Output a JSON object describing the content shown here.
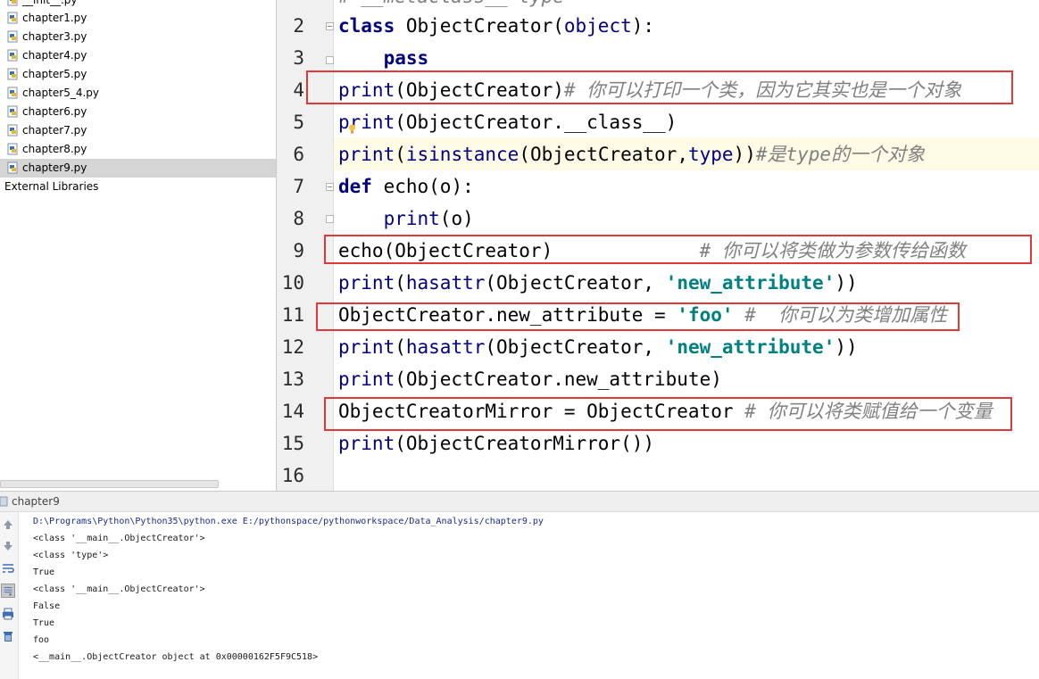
{
  "project_tree": {
    "items": [
      {
        "label": "__init__.py",
        "type": "py"
      },
      {
        "label": "chapter1.py",
        "type": "py"
      },
      {
        "label": "chapter3.py",
        "type": "py"
      },
      {
        "label": "chapter4.py",
        "type": "py"
      },
      {
        "label": "chapter5.py",
        "type": "py"
      },
      {
        "label": "chapter5_4.py",
        "type": "py"
      },
      {
        "label": "chapter6.py",
        "type": "py"
      },
      {
        "label": "chapter7.py",
        "type": "py"
      },
      {
        "label": "chapter8.py",
        "type": "py"
      },
      {
        "label": "chapter9.py",
        "type": "py",
        "selected": true
      }
    ],
    "external_libraries": "External Libraries"
  },
  "editor": {
    "header_partial": "# __metaclass__ type",
    "line_numbers": [
      "2",
      "3",
      "4",
      "5",
      "6",
      "7",
      "8",
      "9",
      "10",
      "11",
      "12",
      "13",
      "14",
      "15",
      "16"
    ],
    "lines": [
      [
        "class",
        " ObjectCreator(",
        "object",
        "):"
      ],
      [
        "    ",
        "pass"
      ],
      [
        "print",
        "(ObjectCreator)",
        "# 你可以打印一个类，因为它其实也是一个对象"
      ],
      [
        "print",
        "(ObjectCreator.__class__)"
      ],
      [
        "print",
        "(",
        "isinstance",
        "(ObjectCreator,",
        "type",
        "))",
        "#是type的一个对象"
      ],
      [
        "def",
        " echo(o):"
      ],
      [
        "    ",
        "print",
        "(o)"
      ],
      [
        "echo(ObjectCreator)",
        "             ",
        "# 你可以将类做为参数传给函数"
      ],
      [
        "print",
        "(",
        "hasattr",
        "(ObjectCreator, ",
        "'new_attribute'",
        "))"
      ],
      [
        "ObjectCreator.new_attribute = ",
        "'foo'",
        " ",
        "#  你可以为类增加属性"
      ],
      [
        "print",
        "(",
        "hasattr",
        "(ObjectCreator, ",
        "'new_attribute'",
        "))"
      ],
      [
        "print",
        "(ObjectCreator.new_attribute)"
      ],
      [
        "ObjectCreatorMirror = ObjectCreator ",
        "# 你可以将类赋值给一个变量"
      ],
      [
        "print",
        "(ObjectCreatorMirror())"
      ],
      [
        ""
      ]
    ]
  },
  "run_panel": {
    "tab_label": "chapter9",
    "output": [
      "D:\\Programs\\Python\\Python35\\python.exe E:/pythonspace/pythonworkspace/Data_Analysis/chapter9.py",
      "<class '__main__.ObjectCreator'>",
      "<class 'type'>",
      "True",
      "<class '__main__.ObjectCreator'>",
      "False",
      "True",
      "foo",
      "<__main__.ObjectCreator object at 0x00000162F5F9C518>"
    ],
    "toolbar": [
      "up-arrow-icon",
      "down-arrow-icon",
      "soft-wrap-icon",
      "scroll-to-end-icon",
      "print-icon",
      "trash-icon"
    ]
  },
  "colors": {
    "keyword": "#000080",
    "string": "#008080",
    "comment": "#808080",
    "highlight_box": "#e0393a",
    "current_line": "#fdfbe5"
  }
}
